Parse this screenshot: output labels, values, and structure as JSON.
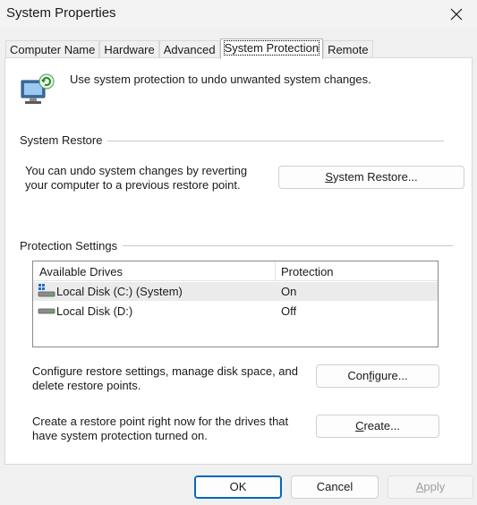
{
  "window": {
    "title": "System Properties"
  },
  "tabs": [
    {
      "label": "Computer Name"
    },
    {
      "label": "Hardware"
    },
    {
      "label": "Advanced"
    },
    {
      "label": "System Protection"
    },
    {
      "label": "Remote"
    }
  ],
  "active_tab": "System Protection",
  "intro_text": "Use system protection to undo unwanted system changes.",
  "system_restore": {
    "group_label": "System Restore",
    "description_line1": "You can undo system changes by reverting",
    "description_line2": "your computer to a previous restore point.",
    "button_prefix": "",
    "button_accel": "S",
    "button_suffix": "ystem Restore..."
  },
  "protection_settings": {
    "group_label": "Protection Settings",
    "columns": [
      "Available Drives",
      "Protection"
    ],
    "drives": [
      {
        "name": "Local Disk (C:) (System)",
        "protection": "On",
        "icon": "system-drive-icon"
      },
      {
        "name": "Local Disk (D:)",
        "protection": "Off",
        "icon": "drive-icon"
      }
    ],
    "configure_desc_line1": "Configure restore settings, manage disk space, and",
    "configure_desc_line2": "delete restore points.",
    "configure_prefix": "Con",
    "configure_accel": "f",
    "configure_suffix": "igure...",
    "create_desc_line1": "Create a restore point right now for the drives that",
    "create_desc_line2": "have system protection turned on.",
    "create_prefix": "",
    "create_accel": "C",
    "create_suffix": "reate..."
  },
  "footer": {
    "ok": "OK",
    "cancel": "Cancel",
    "apply_accel": "A",
    "apply_suffix": "pply"
  },
  "colors": {
    "accent": "#0067c0",
    "selected_row": "#ebebeb"
  }
}
